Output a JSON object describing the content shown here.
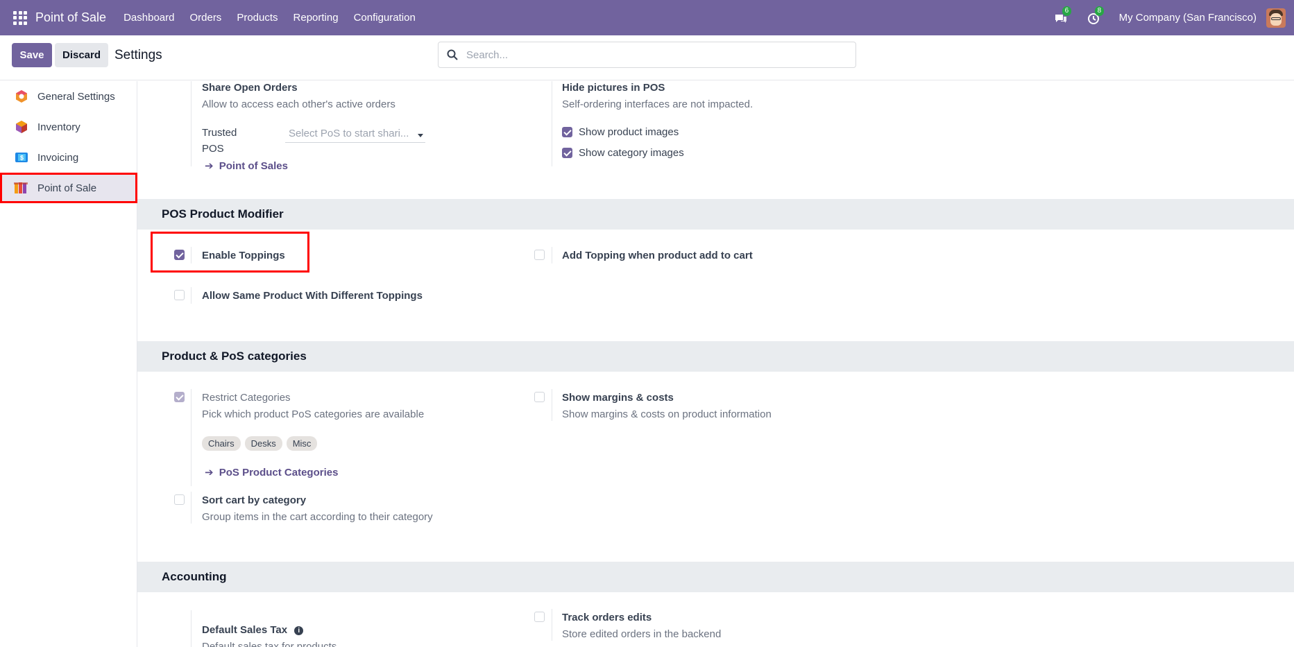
{
  "navbar": {
    "app_name": "Point of Sale",
    "menu": [
      "Dashboard",
      "Orders",
      "Products",
      "Reporting",
      "Configuration"
    ],
    "messages_count": "6",
    "activities_count": "8",
    "company": "My Company (San Francisco)"
  },
  "control": {
    "save_label": "Save",
    "discard_label": "Discard",
    "title": "Settings",
    "search_placeholder": "Search..."
  },
  "sidebar": {
    "items": [
      {
        "label": "General Settings",
        "icon": "general-settings-icon"
      },
      {
        "label": "Inventory",
        "icon": "inventory-icon"
      },
      {
        "label": "Invoicing",
        "icon": "invoicing-icon"
      },
      {
        "label": "Point of Sale",
        "icon": "point-of-sale-icon"
      }
    ],
    "active": "Point of Sale"
  },
  "top_settings": {
    "share_open_orders": {
      "title": "Share Open Orders",
      "desc": "Allow to access each other's active orders"
    },
    "trusted_pos_label_1": "Trusted",
    "trusted_pos_label_2": "POS",
    "trusted_pos_placeholder": "Select PoS to start shari...",
    "point_of_sales_link": "Point of Sales",
    "hide_pictures": {
      "title": "Hide pictures in POS",
      "desc": "Self-ordering interfaces are not impacted."
    },
    "show_product_images": {
      "label": "Show product images",
      "checked": true
    },
    "show_category_images": {
      "label": "Show category images",
      "checked": true
    }
  },
  "pos_product_modifier": {
    "heading": "POS Product Modifier",
    "enable_toppings": {
      "label": "Enable Toppings",
      "checked": true
    },
    "add_topping": {
      "label": "Add Topping when product add to cart",
      "checked": false
    },
    "allow_same_product": {
      "label": "Allow Same Product With Different Toppings",
      "checked": false
    }
  },
  "product_categories": {
    "heading": "Product & PoS categories",
    "restrict_categories": {
      "title": "Restrict Categories",
      "desc": "Pick which product PoS categories are available",
      "checked": true
    },
    "tags": [
      "Chairs",
      "Desks",
      "Misc"
    ],
    "pos_product_categories_link": "PoS Product Categories",
    "show_margins": {
      "title": "Show margins & costs",
      "desc": "Show margins & costs on product information",
      "checked": false
    },
    "sort_cart": {
      "title": "Sort cart by category",
      "desc": "Group items in the cart according to their category",
      "checked": false
    }
  },
  "accounting": {
    "heading": "Accounting",
    "default_sales_tax": {
      "title": "Default Sales Tax",
      "desc": "Default sales tax for products"
    },
    "track_orders": {
      "title": "Track orders edits",
      "desc": "Store edited orders in the backend",
      "checked": false
    }
  },
  "colors": {
    "brand": "#71639e",
    "highlight": "#ff0000"
  }
}
